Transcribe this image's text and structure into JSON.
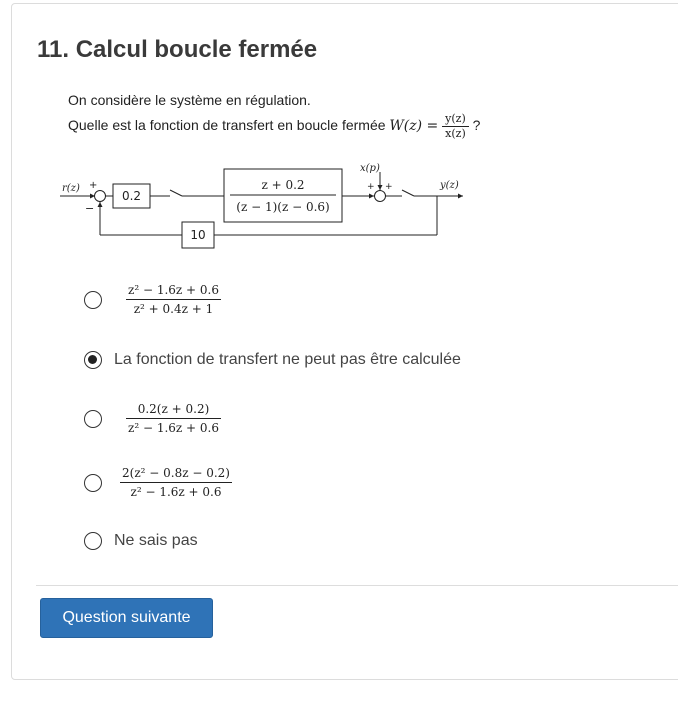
{
  "question": {
    "title": "11. Calcul boucle fermée",
    "line1": "On considère le système en régulation.",
    "line2": "Quelle est la fonction de transfert en boucle fermée",
    "w_label": "W(z) =",
    "w_num": "y(z)",
    "w_den": "x(z)",
    "qmark": "?"
  },
  "diagram": {
    "input_label": "r(z)",
    "plus": "+",
    "minus": "−",
    "controller_gain": "0.2",
    "plant_num": "z + 0.2",
    "plant_den": "(z − 1)(z − 0.6)",
    "disturbance_label": "x(p)",
    "output_label": "y(z)",
    "feedback_gain": "10"
  },
  "options": [
    {
      "type": "fraction",
      "num": "z² − 1.6z + 0.6",
      "den": "z² + 0.4z + 1",
      "selected": false
    },
    {
      "type": "text",
      "label": "La fonction de transfert ne peut pas être calculée",
      "selected": true
    },
    {
      "type": "fraction",
      "num": "0.2(z + 0.2)",
      "den": "z² − 1.6z + 0.6",
      "selected": false
    },
    {
      "type": "fraction",
      "num": "2(z² − 0.8z − 0.2)",
      "den": "z² − 1.6z + 0.6",
      "selected": false
    },
    {
      "type": "text",
      "label": "Ne sais pas",
      "selected": false
    }
  ],
  "next_button": "Question suivante"
}
